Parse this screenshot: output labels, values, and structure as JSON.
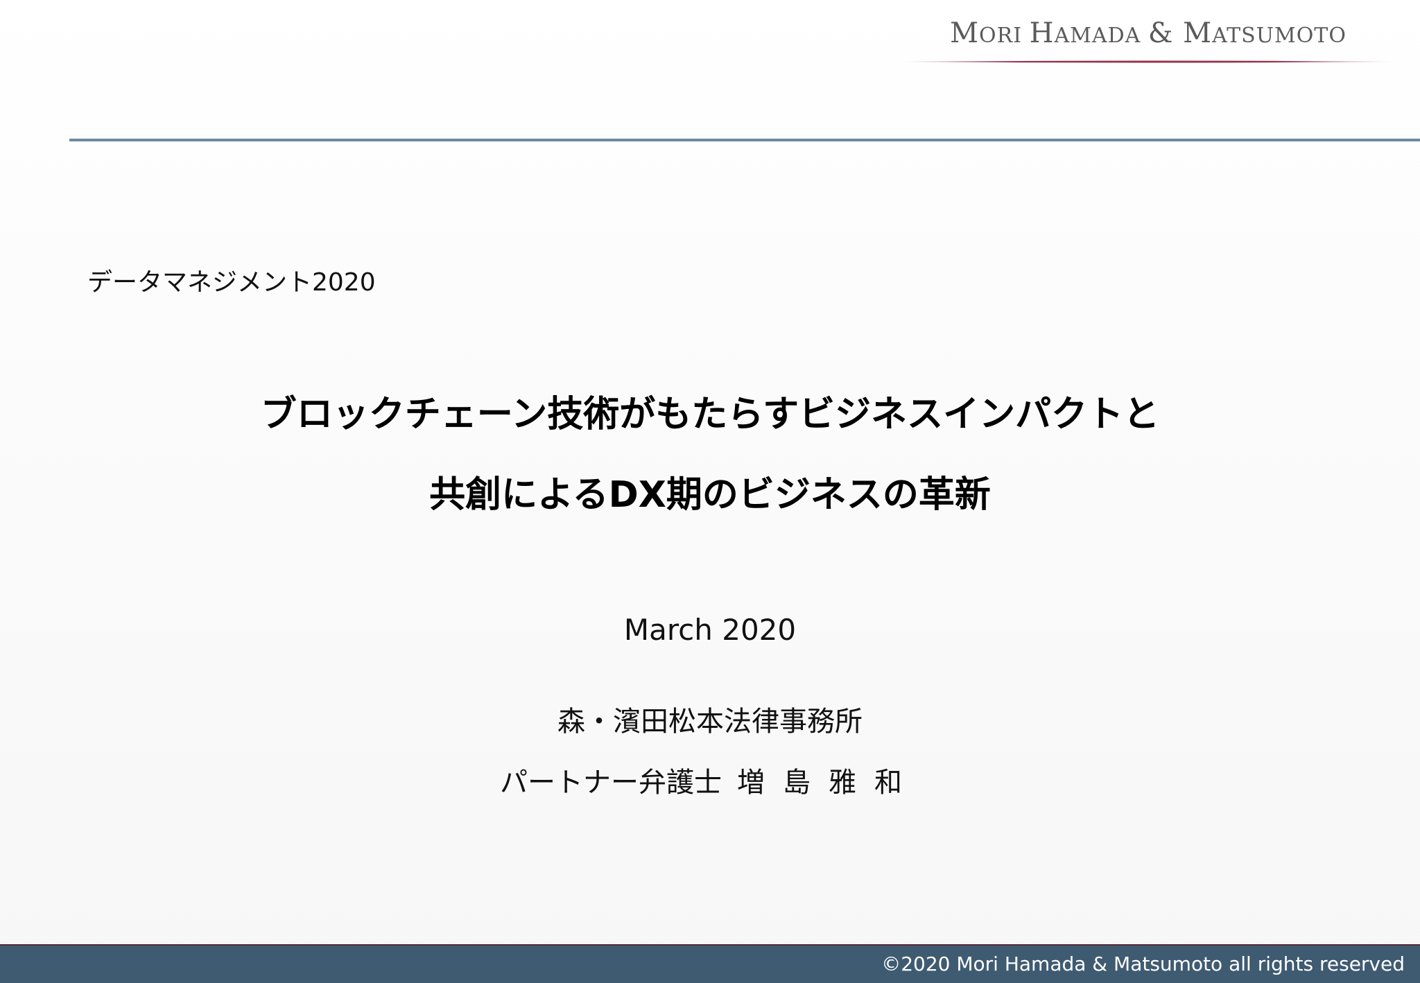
{
  "logo": {
    "text": "Mori Hamada & Matsumoto",
    "parts": [
      "M",
      "ORI ",
      "H",
      "AMADA ",
      "& ",
      "M",
      "ATSUMOTO"
    ],
    "underline_color": "#8b1a3a",
    "text_color": "#5a5a5a"
  },
  "event": {
    "label": "データマネジメント2020"
  },
  "title": {
    "line1": "ブロックチェーン技術がもたらすビジネスインパクトと",
    "line2": "共創によるDX期のビジネスの革新"
  },
  "date": "March 2020",
  "firm_name": "森・濱田松本法律事務所",
  "presenter": {
    "role": "パートナー弁護士",
    "name": "増島雅和"
  },
  "footer": {
    "copyright": "©2020 Mori Hamada & Matsumoto all rights reserved",
    "background": "#3f5b72"
  },
  "colors": {
    "header_rule": "#6d8aa1"
  }
}
